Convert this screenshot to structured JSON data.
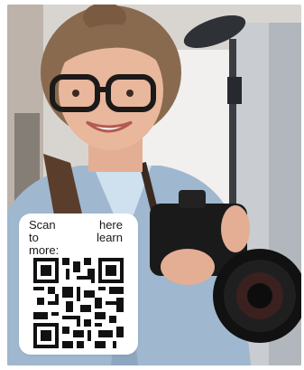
{
  "qr_card": {
    "line1": "Scan here",
    "line2": "to learn",
    "line3": "more:"
  },
  "scene": {
    "subject": "smiling-photographer-with-camera",
    "colors": {
      "background": "#d8d5d1",
      "denim": "#9fb7cf",
      "skin": "#e8b79c",
      "hair": "#8a6a4f",
      "camera": "#1a1a1a"
    }
  }
}
